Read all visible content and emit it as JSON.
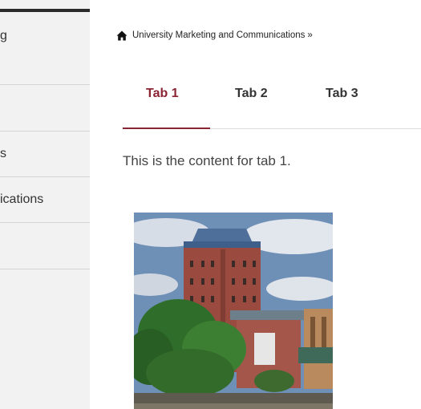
{
  "sidebar": {
    "items": [
      {
        "label": "g"
      },
      {
        "label": ""
      },
      {
        "label": "s"
      },
      {
        "label": "ications"
      },
      {
        "label": ""
      }
    ]
  },
  "breadcrumb": {
    "home_icon": "home-icon",
    "link_label": "University Marketing and Communications",
    "separator": "»"
  },
  "tabs": {
    "items": [
      {
        "label": "Tab 1",
        "active": true
      },
      {
        "label": "Tab 2",
        "active": false
      },
      {
        "label": "Tab 3",
        "active": false
      }
    ],
    "active_color": "#8a2432"
  },
  "content": {
    "text": "This is the content for tab 1."
  }
}
